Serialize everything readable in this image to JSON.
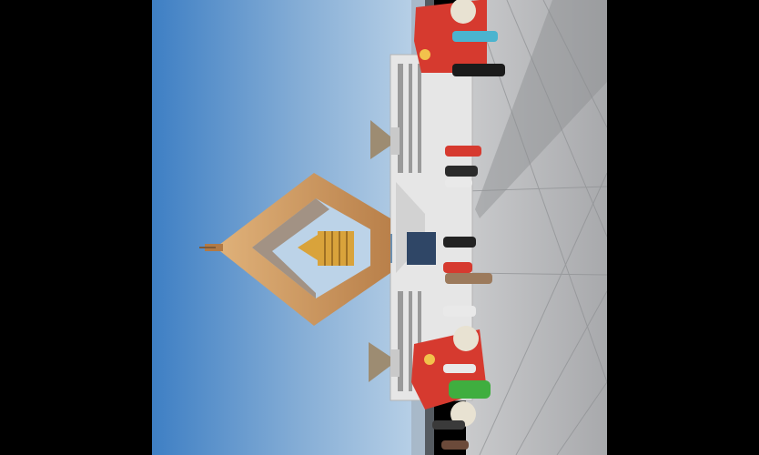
{
  "image": {
    "kind": "photograph",
    "orientation": "rotated-90-clockwise",
    "subject": "temple-with-diamond-shaped-frame-and-golden-pagoda",
    "colors": {
      "sky_top": "#3e7fc4",
      "sky_bottom": "#bcd3e8",
      "frame_gold": "#c8935a",
      "frame_shadow": "#8c5c32",
      "pagoda_gold": "#d9a33b",
      "building_white": "#e6e6e6",
      "plaza_grey": "#b9babd",
      "decoration_red": "#d63a2f"
    }
  }
}
